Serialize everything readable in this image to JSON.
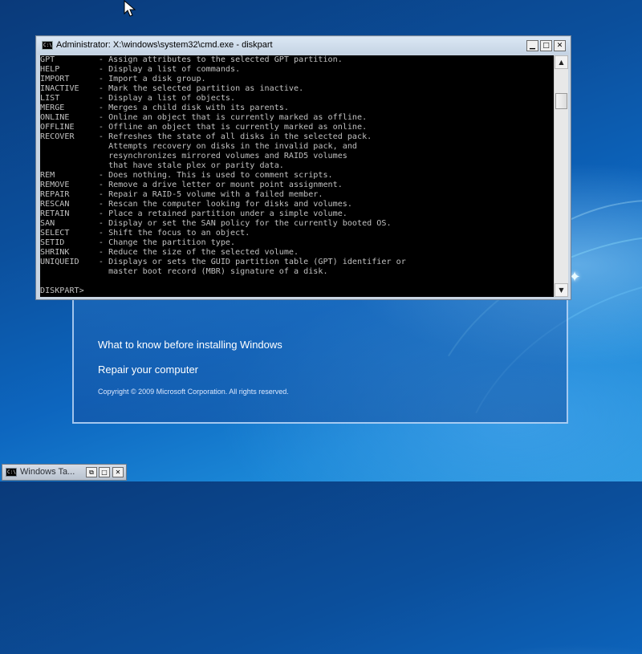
{
  "cmd": {
    "title": "Administrator: X:\\windows\\system32\\cmd.exe - diskpart",
    "icon_label": "C:\\",
    "buttons": {
      "minimize": "▁",
      "maximize": "□",
      "close": "✕"
    },
    "lines": [
      "GPT         - Assign attributes to the selected GPT partition.",
      "HELP        - Display a list of commands.",
      "IMPORT      - Import a disk group.",
      "INACTIVE    - Mark the selected partition as inactive.",
      "LIST        - Display a list of objects.",
      "MERGE       - Merges a child disk with its parents.",
      "ONLINE      - Online an object that is currently marked as offline.",
      "OFFLINE     - Offline an object that is currently marked as online.",
      "RECOVER     - Refreshes the state of all disks in the selected pack.",
      "              Attempts recovery on disks in the invalid pack, and",
      "              resynchronizes mirrored volumes and RAID5 volumes",
      "              that have stale plex or parity data.",
      "REM         - Does nothing. This is used to comment scripts.",
      "REMOVE      - Remove a drive letter or mount point assignment.",
      "REPAIR      - Repair a RAID-5 volume with a failed member.",
      "RESCAN      - Rescan the computer looking for disks and volumes.",
      "RETAIN      - Place a retained partition under a simple volume.",
      "SAN         - Display or set the SAN policy for the currently booted OS.",
      "SELECT      - Shift the focus to an object.",
      "SETID       - Change the partition type.",
      "SHRINK      - Reduce the size of the selected volume.",
      "UNIQUEID    - Displays or sets the GUID partition table (GPT) identifier or",
      "              master boot record (MBR) signature of a disk.",
      "",
      "DISKPART>"
    ]
  },
  "setup": {
    "link_what_to_know": "What to know before installing Windows",
    "link_repair": "Repair your computer",
    "copyright": "Copyright © 2009 Microsoft Corporation. All rights reserved."
  },
  "taskbar": {
    "label": "Windows Ta...",
    "icon_label": "C:\\",
    "buttons": {
      "restore": "⧉",
      "maximize": "□",
      "close": "✕"
    }
  },
  "scrollbar": {
    "position_fraction": 0.12
  }
}
